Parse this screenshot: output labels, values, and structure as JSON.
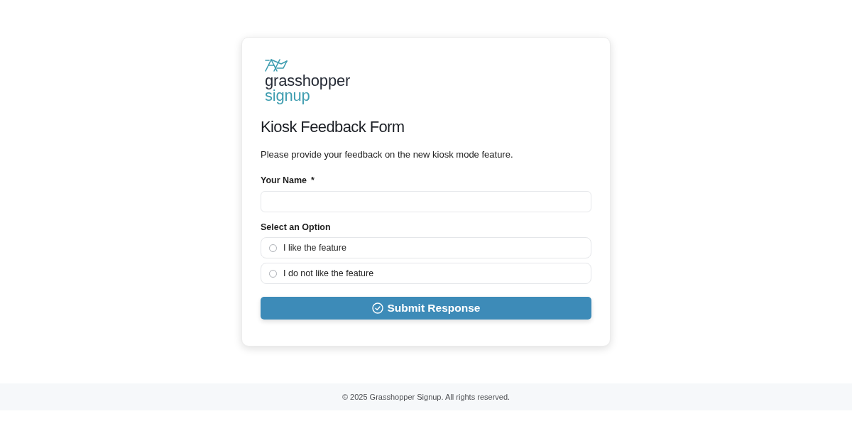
{
  "logo": {
    "line_1": "grasshopper",
    "line_2": "signup"
  },
  "form": {
    "title": "Kiosk Feedback Form",
    "description": "Please provide your feedback on the new kiosk mode feature.",
    "name_field": {
      "label": "Your Name",
      "required_mark": "*"
    },
    "option_group": {
      "label": "Select an Option",
      "options": [
        {
          "label": "I like the feature",
          "selected": false
        },
        {
          "label": "I do not like the feature",
          "selected": false
        }
      ]
    },
    "submit_button": {
      "label": "Submit Response"
    }
  },
  "footer": {
    "text": "© 2025 Grasshopper Signup. All rights reserved."
  }
}
